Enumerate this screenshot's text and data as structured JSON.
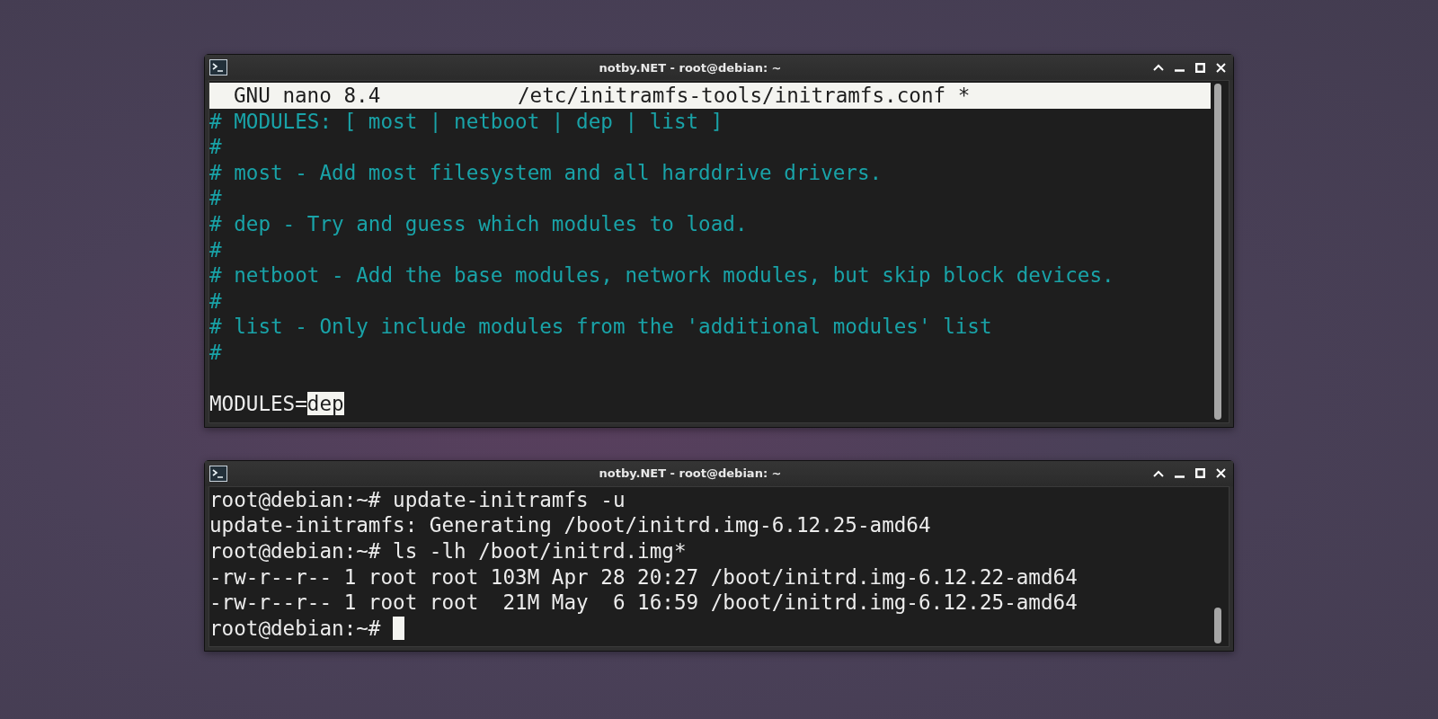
{
  "windows": [
    {
      "title": "notby.NET - root@debian: ~",
      "kind": "nano",
      "nano": {
        "version": "GNU nano 8.4",
        "filename": "/etc/initramfs-tools/initramfs.conf *",
        "lines": [
          {
            "kind": "comment",
            "text": "# MODULES: [ most | netboot | dep | list ]"
          },
          {
            "kind": "comment",
            "text": "#"
          },
          {
            "kind": "comment",
            "text": "# most - Add most filesystem and all harddrive drivers."
          },
          {
            "kind": "comment",
            "text": "#"
          },
          {
            "kind": "comment",
            "text": "# dep - Try and guess which modules to load."
          },
          {
            "kind": "comment",
            "text": "#"
          },
          {
            "kind": "comment",
            "text": "# netboot - Add the base modules, network modules, but skip block devices."
          },
          {
            "kind": "comment",
            "text": "#"
          },
          {
            "kind": "comment",
            "text": "# list - Only include modules from the 'additional modules' list"
          },
          {
            "kind": "comment",
            "text": "#"
          },
          {
            "kind": "blank"
          },
          {
            "kind": "code",
            "text": "MODULES=",
            "selected_text": "dep"
          }
        ]
      }
    },
    {
      "title": "notby.NET - root@debian: ~",
      "kind": "terminal",
      "terminal": {
        "lines": [
          "root@debian:~# update-initramfs -u",
          "update-initramfs: Generating /boot/initrd.img-6.12.25-amd64",
          "root@debian:~# ls -lh /boot/initrd.img*",
          "-rw-r--r-- 1 root root 103M Apr 28 20:27 /boot/initrd.img-6.12.22-amd64",
          "-rw-r--r-- 1 root root  21M May  6 16:59 /boot/initrd.img-6.12.25-amd64"
        ],
        "prompt": "root@debian:~#"
      }
    }
  ]
}
